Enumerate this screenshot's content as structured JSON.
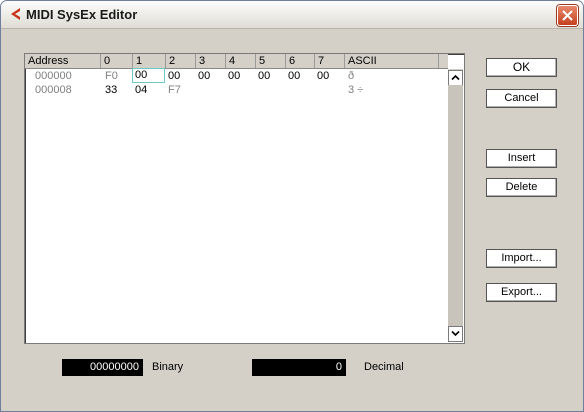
{
  "window": {
    "title": "MIDI SysEx Editor"
  },
  "grid": {
    "headers": [
      "Address",
      "0",
      "1",
      "2",
      "3",
      "4",
      "5",
      "6",
      "7",
      "ASCII"
    ],
    "rows": [
      {
        "address": "000000",
        "bytes": [
          "F0",
          "00",
          "00",
          "00",
          "00",
          "00",
          "00",
          "00"
        ],
        "ascii": "ð"
      },
      {
        "address": "000008",
        "bytes": [
          "33",
          "04",
          "F7",
          "",
          "",
          "",
          "",
          ""
        ],
        "ascii": "3 ÷"
      }
    ]
  },
  "buttons": {
    "ok": "OK",
    "cancel": "Cancel",
    "insert": "Insert",
    "delete": "Delete",
    "import": "Import...",
    "export": "Export..."
  },
  "fields": {
    "binary_value": "00000000",
    "binary_label": "Binary",
    "decimal_value": "0",
    "decimal_label": "Decimal"
  },
  "colors": {
    "dialog_bg": "#d4d0c8",
    "close_button": "#c4401f",
    "app_icon": "#c8341a",
    "selection_outline": "#6fc7c7"
  }
}
